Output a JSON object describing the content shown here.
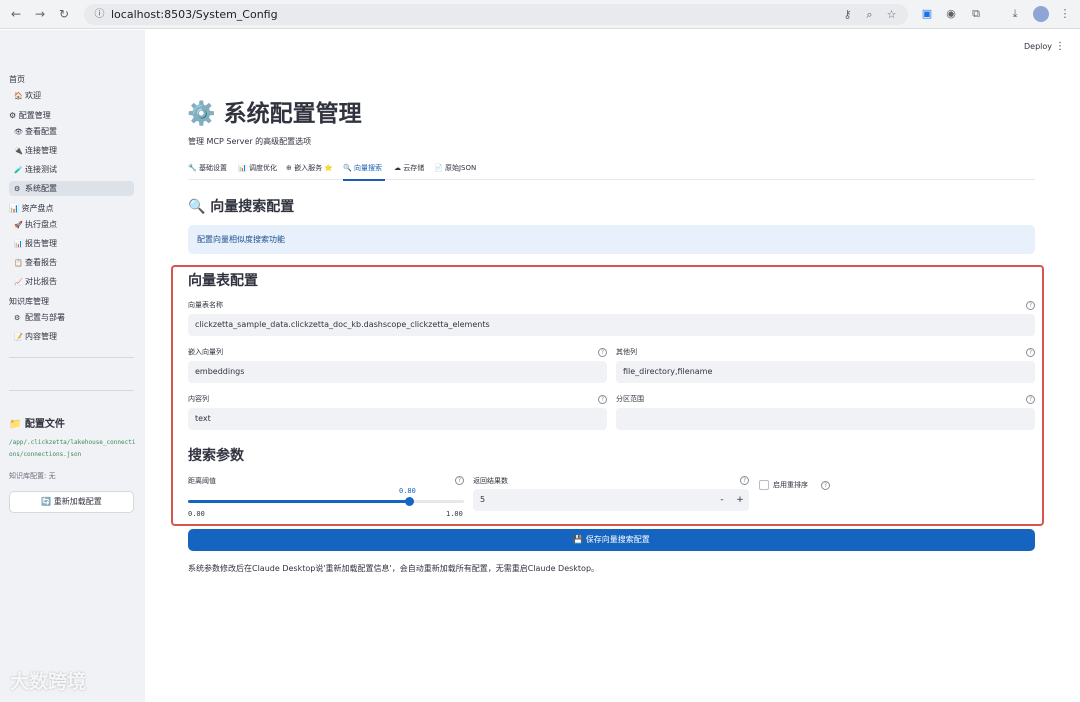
{
  "browser": {
    "url": "localhost:8503/System_Config",
    "nav_icons": [
      "back-icon",
      "forward-icon",
      "reload-icon"
    ]
  },
  "app": {
    "deploy_label": "Deploy",
    "menu_glyph": "⋮"
  },
  "sidebar": {
    "sections": [
      {
        "label": "首页",
        "items": [
          {
            "icon": "🏠",
            "label": "欢迎",
            "active": false
          }
        ]
      },
      {
        "label": "⚙ 配置管理",
        "items": [
          {
            "icon": "👁",
            "label": "查看配置",
            "active": false
          },
          {
            "icon": "🔌",
            "label": "连接管理",
            "active": false
          },
          {
            "icon": "🧪",
            "label": "连接测试",
            "active": false
          },
          {
            "icon": "⚙",
            "label": "系统配置",
            "active": true
          }
        ]
      },
      {
        "label": "📊 资产盘点",
        "items": [
          {
            "icon": "🚀",
            "label": "执行盘点",
            "active": false
          },
          {
            "icon": "📊",
            "label": "报告管理",
            "active": false
          },
          {
            "icon": "📋",
            "label": "查看报告",
            "active": false
          },
          {
            "icon": "📈",
            "label": "对比报告",
            "active": false
          }
        ]
      },
      {
        "label": "知识库管理",
        "items": [
          {
            "icon": "⚙",
            "label": "配置与部署",
            "active": false
          },
          {
            "icon": "📝",
            "label": "内容管理",
            "active": false
          }
        ]
      }
    ],
    "config_file_title": "📁 配置文件",
    "config_file_path": "/app/.clickzetta/lakehouse_connections/connections.json",
    "kb_config_text": "知识库配置: 无",
    "reload_button": "🔄 重新加载配置"
  },
  "main": {
    "title": "⚙️ 系统配置管理",
    "subtitle": "管理 MCP Server 的高级配置选项",
    "tabs": [
      {
        "label": "🔧 基础设置",
        "active": false
      },
      {
        "label": "📊 调度优化",
        "active": false
      },
      {
        "label": "⊕ 嵌入服务 ⭐",
        "active": false
      },
      {
        "label": "🔍 向量搜索",
        "active": true
      },
      {
        "label": "☁ 云存储",
        "active": false
      },
      {
        "label": "📄 原始JSON",
        "active": false
      }
    ],
    "section_title": "🔍 向量搜索配置",
    "info_text": "配置向量相似度搜索功能",
    "vector_table": {
      "heading": "向量表配置",
      "table_name_label": "向量表名称",
      "table_name_value": "clickzetta_sample_data.clickzetta_doc_kb.dashscope_clickzetta_elements",
      "embedding_col_label": "嵌入向量列",
      "embedding_col_value": "embeddings",
      "other_cols_label": "其他列",
      "other_cols_value": "file_directory,filename",
      "content_col_label": "内容列",
      "content_col_value": "text",
      "partition_label": "分区范围",
      "partition_value": ""
    },
    "search_params": {
      "heading": "搜索参数",
      "distance_label": "距离阈值",
      "distance_value": "0.80",
      "distance_fraction": 0.8,
      "distance_min": "0.00",
      "distance_max": "1.00",
      "results_label": "返回结果数",
      "results_value": "5",
      "minus": "-",
      "plus": "+",
      "rerank_label": "启用重排序",
      "rerank_checked": false
    },
    "save_button": "💾 保存向量搜索配置",
    "footnote": "系统参数修改后在Claude Desktop说'重新加载配置信息'，会自动重新加载所有配置，无需重启Claude Desktop。"
  },
  "watermark": "大数跨境",
  "colors": {
    "accent": "#1565c0",
    "highlight_frame": "#d9534f",
    "sidebar_bg": "#f0f2f6",
    "info_bg": "#e8f0fb"
  }
}
